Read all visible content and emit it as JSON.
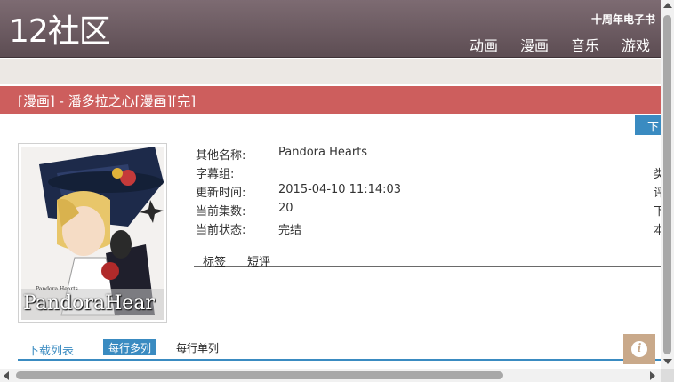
{
  "header": {
    "logo": "12社区",
    "anniversary": "十周年电子书",
    "nav": [
      "动画",
      "漫画",
      "音乐",
      "游戏"
    ]
  },
  "title_bar": {
    "text": "[漫画] - 潘多拉之心[漫画][完]"
  },
  "download_tab": {
    "label": "下"
  },
  "cover": {
    "caption": "PandoraHear",
    "small_text": "Pandora Hearts"
  },
  "info": {
    "rows": [
      {
        "label": "其他名称:",
        "value": "Pandora Hearts"
      },
      {
        "label": "字幕组:",
        "value": ""
      },
      {
        "label": "更新时间:",
        "value": "2015-04-10 11:14:03"
      },
      {
        "label": "当前集数:",
        "value": "20"
      },
      {
        "label": "当前状态:",
        "value": "完结"
      }
    ],
    "right_clipped": [
      "类",
      "评",
      "下",
      "本"
    ]
  },
  "subtabs": [
    "标签",
    "短评"
  ],
  "download_list": {
    "title": "下载列表",
    "modes": [
      "每行多列",
      "每行单列"
    ],
    "active_mode": "每行多列"
  },
  "colors": {
    "title_bar": "#cd5e5d",
    "accent": "#3a8bc1",
    "header": "#6d5c63"
  }
}
